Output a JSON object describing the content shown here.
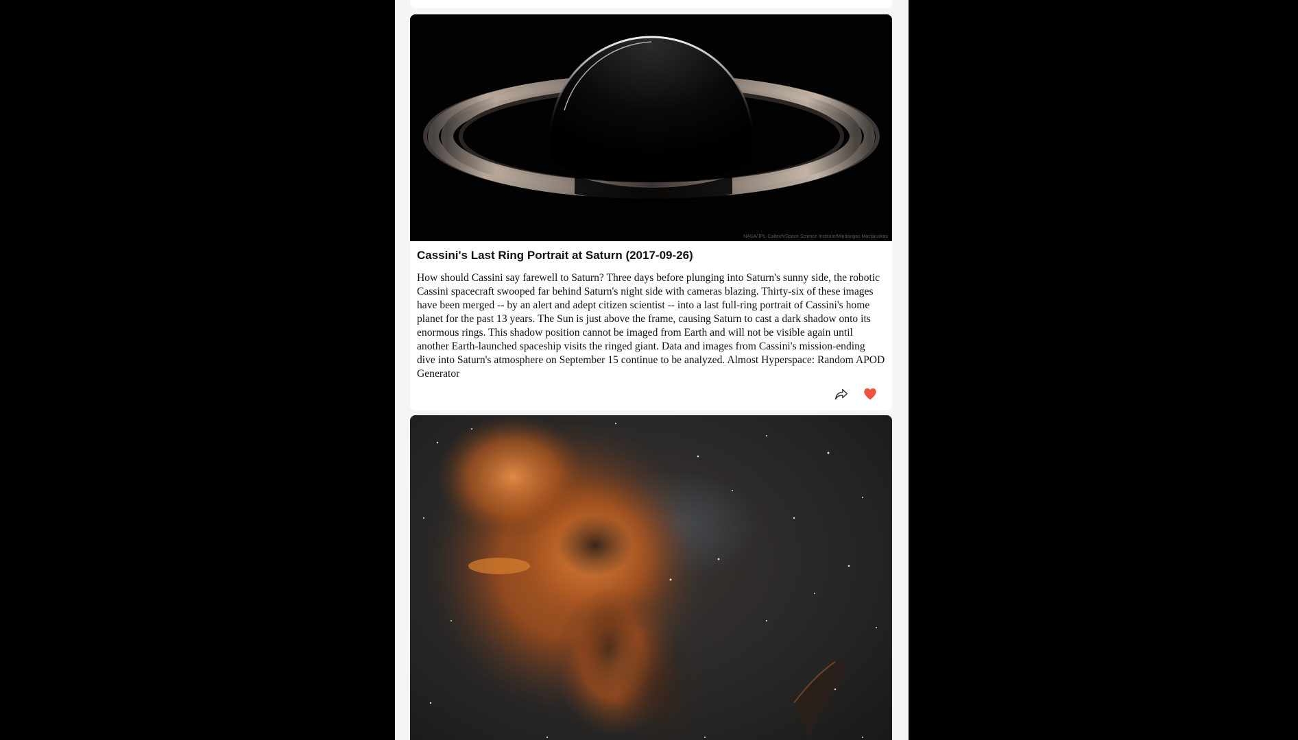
{
  "feed": {
    "cards": [
      {
        "title": "Cassini's Last Ring Portrait at Saturn (2017-09-26)",
        "image_credit": "NASA/JPL-Caltech/Space Science Institute/Mindaugas Macijauskas",
        "description": "How should Cassini say farewell to Saturn? Three days before plunging into Saturn's sunny side, the robotic Cassini spacecraft swooped far behind Saturn's night side with cameras blazing. Thirty-six of these images have been merged -- by an alert and adept citizen scientist -- into a last full-ring portrait of Cassini's home planet for the past 13 years. The Sun is just above the frame, causing Saturn to cast a dark shadow onto its enormous rings. This shadow position cannot be imaged from Earth and will not be visible again until another Earth-launched spaceship visits the ringed giant. Data and images from Cassini's mission-ending dive into Saturn's atmosphere on September 15 continue to be analyzed. Almost Hyperspace: Random APOD Generator",
        "liked": true
      }
    ]
  },
  "icons": {
    "share": "share-icon",
    "like": "heart-icon"
  },
  "colors": {
    "page_background": "#000000",
    "feed_background": "#f5f5f5",
    "card_background": "#ffffff",
    "like_active": "#f0533b"
  }
}
